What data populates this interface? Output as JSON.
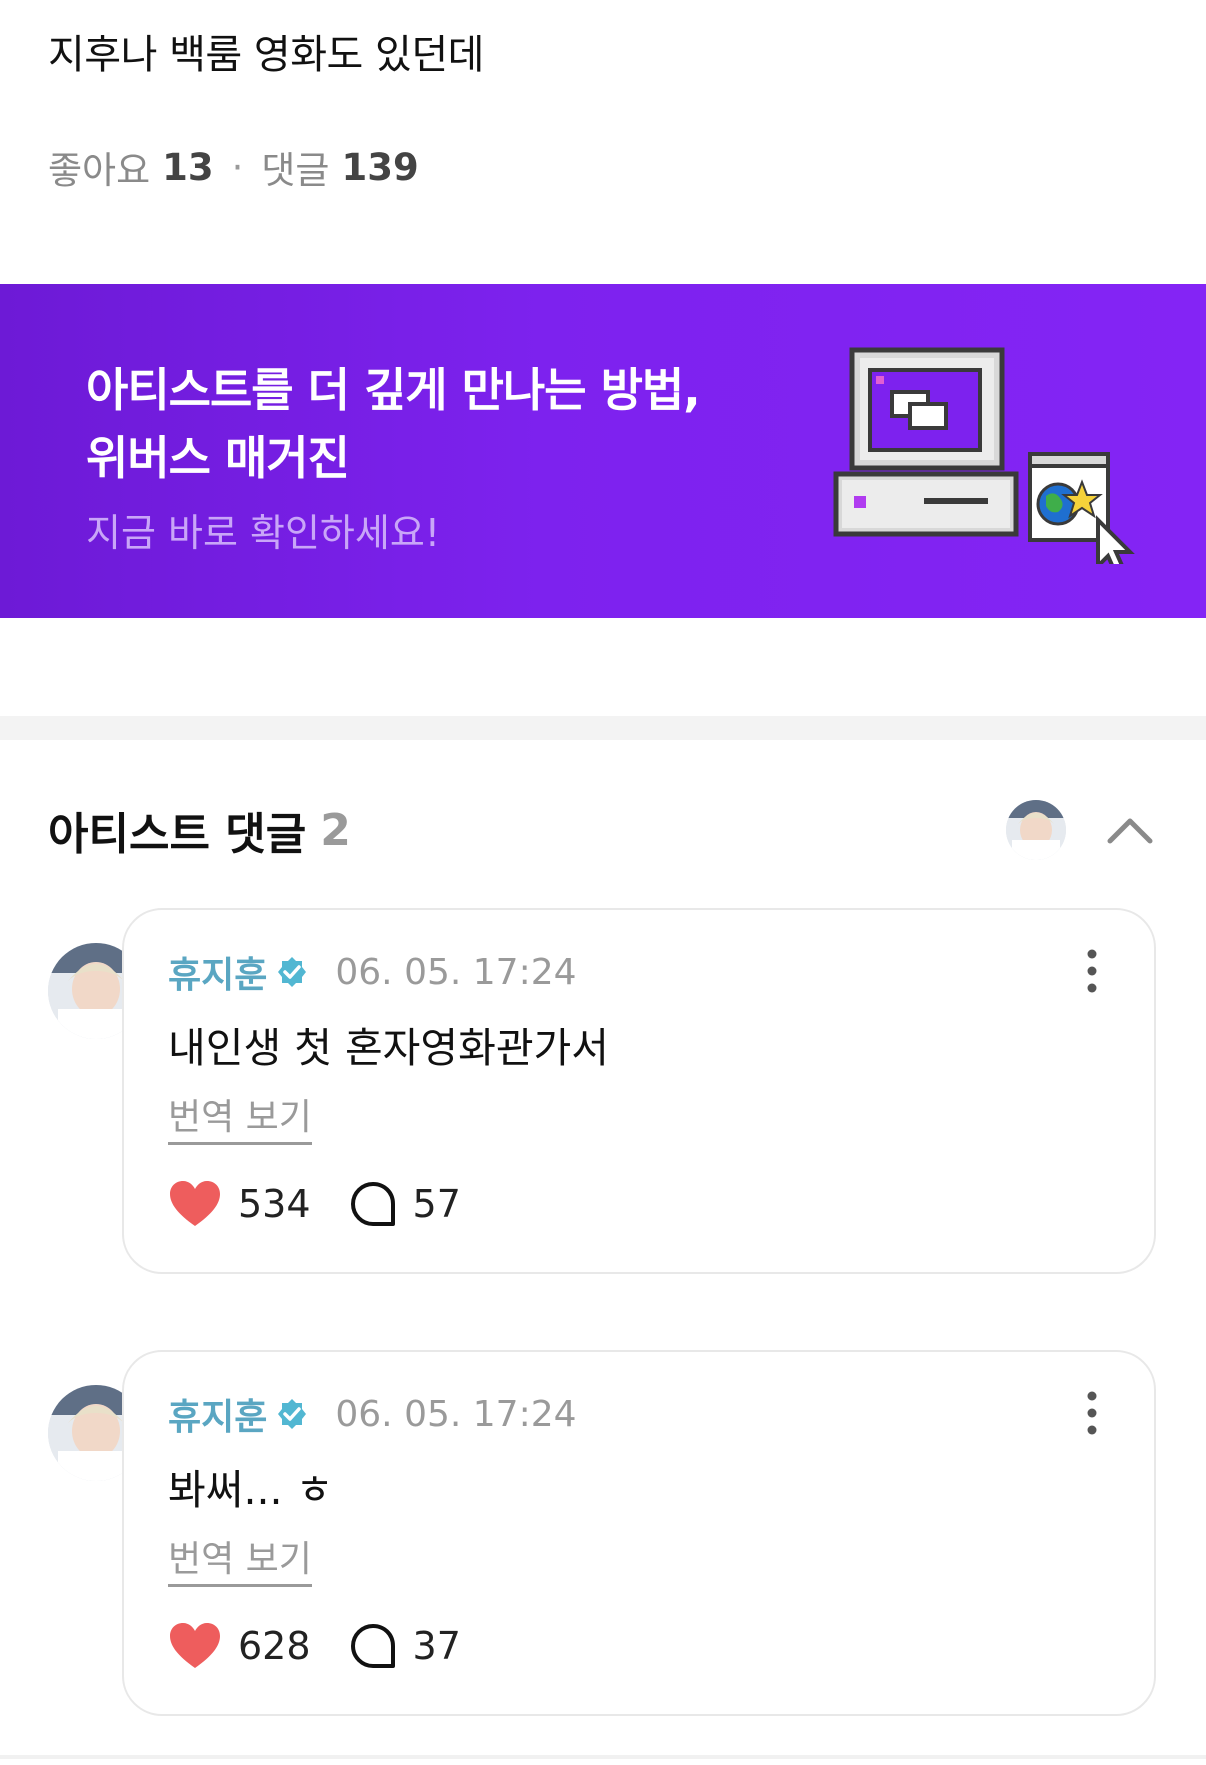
{
  "post": {
    "text": "지후나 백룸 영화도 있던데",
    "like_label": "좋아요",
    "like_count": "13",
    "separator": "·",
    "comment_label": "댓글",
    "comment_count": "139"
  },
  "banner": {
    "line1": "아티스트를 더 깊게 만나는 방법,",
    "line2": "위버스 매거진",
    "subtitle": "지금 바로 확인하세요!",
    "bg_color": "#7d22ee",
    "illustration_icons": [
      "retro-computer-icon",
      "browser-window-icon",
      "globe-star-icon",
      "mouse-cursor-icon"
    ]
  },
  "artist_comments": {
    "title": "아티스트 댓글",
    "count": "2",
    "collapse_icon": "chevron-up-icon",
    "items": [
      {
        "author": "휴지훈",
        "time": "06. 05. 17:24",
        "text": "내인생 첫 혼자영화관가서",
        "translate_label": "번역 보기",
        "likes": "534",
        "replies": "57"
      },
      {
        "author": "휴지훈",
        "time": "06. 05. 17:24",
        "text": "봐써... ㅎ",
        "translate_label": "번역 보기",
        "likes": "628",
        "replies": "37"
      }
    ]
  },
  "colors": {
    "author": "#5aa6c2",
    "verified": "#52b7d2",
    "heart": "#ee5d5d",
    "muted": "#9a9a9a"
  }
}
